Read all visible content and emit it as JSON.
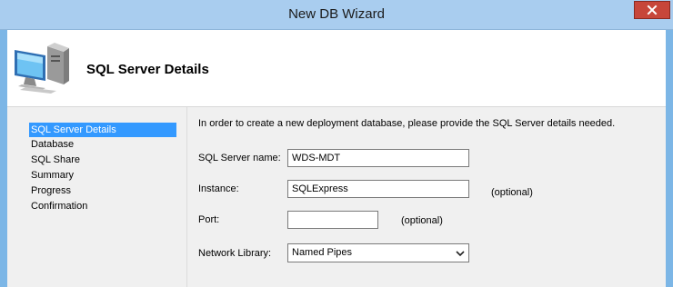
{
  "window": {
    "title": "New DB Wizard"
  },
  "header": {
    "title": "SQL Server Details",
    "icon": "computer-icon"
  },
  "sidebar": {
    "items": [
      {
        "label": "SQL Server Details",
        "selected": true
      },
      {
        "label": "Database"
      },
      {
        "label": "SQL Share"
      },
      {
        "label": "Summary"
      },
      {
        "label": "Progress"
      },
      {
        "label": "Confirmation"
      }
    ]
  },
  "form": {
    "intro": "In order to create a new deployment database, please provide the SQL Server details needed.",
    "server_name": {
      "label": "SQL Server name:",
      "value": "WDS-MDT"
    },
    "instance": {
      "label": "Instance:",
      "value": "SQLExpress",
      "note": "(optional)"
    },
    "port": {
      "label": "Port:",
      "value": "",
      "note": "(optional)"
    },
    "network_library": {
      "label": "Network Library:",
      "value": "Named Pipes"
    }
  },
  "colors": {
    "titlebar": "#a9cdef",
    "close_button": "#c7463a",
    "selection": "#3399ff",
    "panel": "#f0f0f0"
  }
}
